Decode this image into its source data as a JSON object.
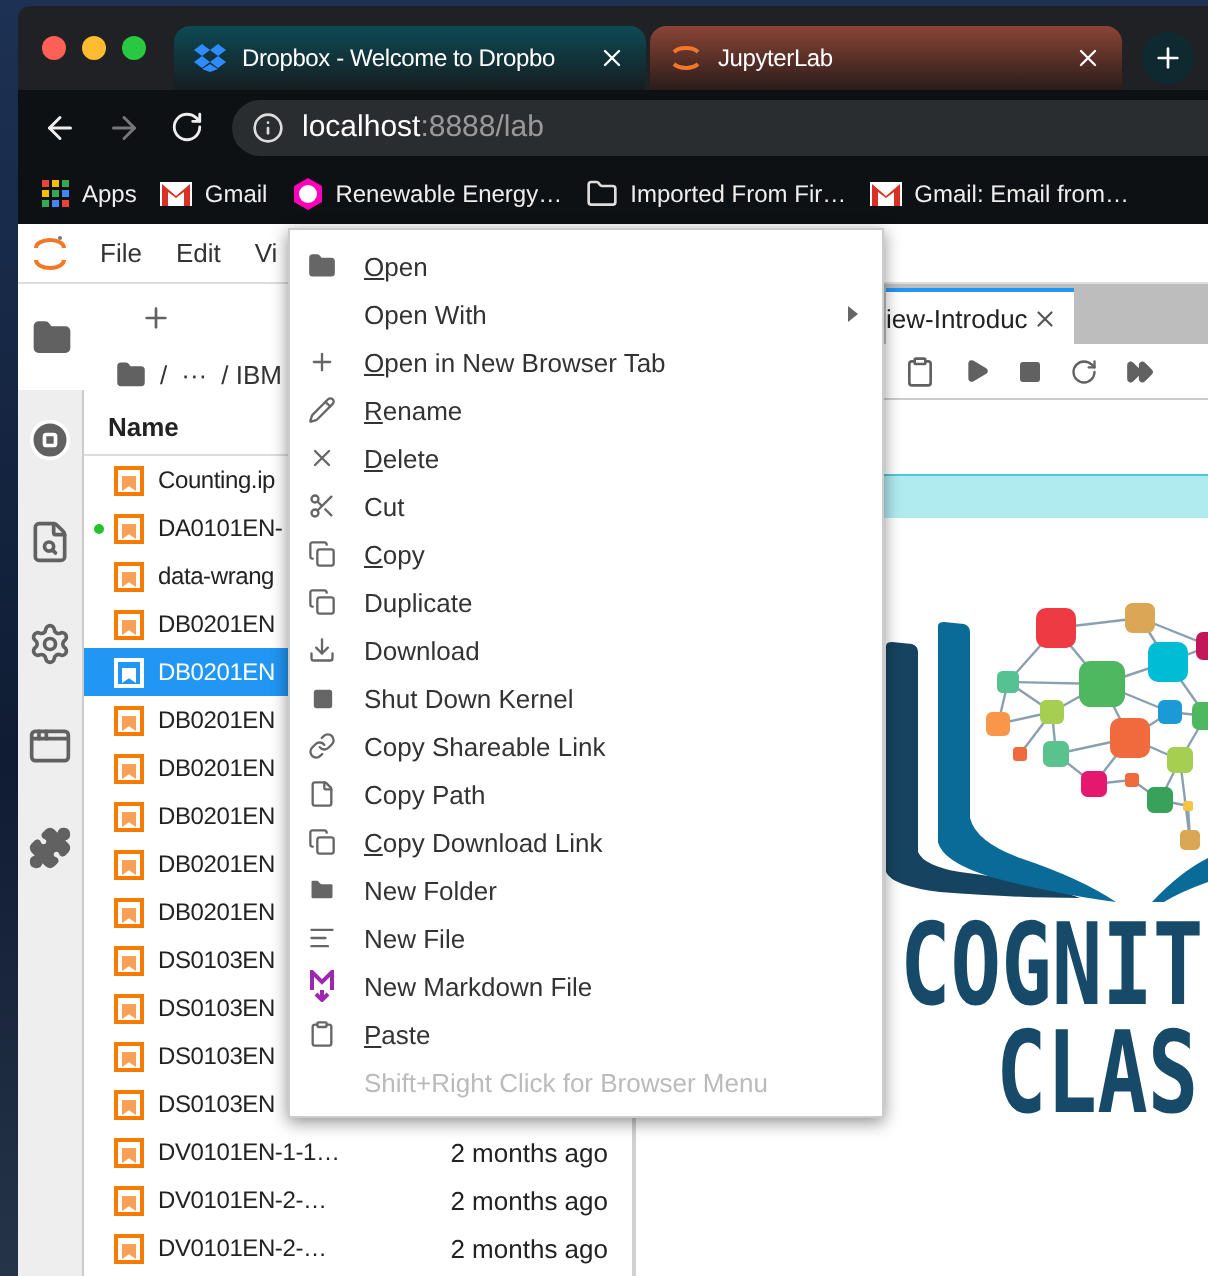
{
  "browser": {
    "tabs": [
      {
        "title": "Dropbox - Welcome to Dropbo",
        "selected": false
      },
      {
        "title": "JupyterLab",
        "selected": true
      }
    ],
    "address": {
      "host": "localhost",
      "path": ":8888/lab"
    },
    "bookmarks": [
      {
        "label": "Apps"
      },
      {
        "label": "Gmail"
      },
      {
        "label": "Renewable Energy…"
      },
      {
        "label": "Imported From Fir…"
      },
      {
        "label": "Gmail: Email from…"
      }
    ]
  },
  "jupyter": {
    "menu": [
      "File",
      "Edit",
      "Vi"
    ],
    "file_browser": {
      "breadcrumb": [
        "/",
        "···",
        "/ IBM"
      ],
      "column": "Name",
      "rows": [
        {
          "name": "Counting.ip",
          "selected": false,
          "running": false
        },
        {
          "name": "DA0101EN-",
          "selected": false,
          "running": true
        },
        {
          "name": "data-wrang",
          "selected": false,
          "running": false
        },
        {
          "name": "DB0201EN",
          "selected": false,
          "running": false
        },
        {
          "name": "DB0201EN",
          "selected": true,
          "running": false
        },
        {
          "name": "DB0201EN",
          "selected": false,
          "running": false
        },
        {
          "name": "DB0201EN",
          "selected": false,
          "running": false
        },
        {
          "name": "DB0201EN",
          "selected": false,
          "running": false
        },
        {
          "name": "DB0201EN",
          "selected": false,
          "running": false
        },
        {
          "name": "DB0201EN",
          "selected": false,
          "running": false
        },
        {
          "name": "DS0103EN",
          "selected": false,
          "running": false
        },
        {
          "name": "DS0103EN",
          "selected": false,
          "running": false
        },
        {
          "name": "DS0103EN",
          "selected": false,
          "running": false
        },
        {
          "name": "DS0103EN",
          "selected": false,
          "running": false
        },
        {
          "name": "DV0101EN-1-1…",
          "modified": "2 months ago",
          "selected": false,
          "running": false
        },
        {
          "name": "DV0101EN-2-…",
          "modified": "2 months ago",
          "selected": false,
          "running": false
        },
        {
          "name": "DV0101EN-2-…",
          "modified": "2 months ago",
          "selected": false,
          "running": false
        }
      ]
    },
    "notebook": {
      "tab": "iew-Introduc",
      "logo_lines": [
        "COGNIT",
        "CLAS"
      ]
    },
    "context_menu": [
      {
        "label": "Open",
        "mnemonic": true,
        "submenu": false,
        "disabled": false
      },
      {
        "label": "Open With",
        "mnemonic": false,
        "submenu": true,
        "disabled": false
      },
      {
        "label": "Open in New Browser Tab",
        "mnemonic": true,
        "submenu": false,
        "disabled": false
      },
      {
        "label": "Rename",
        "mnemonic": true,
        "submenu": false,
        "disabled": false
      },
      {
        "label": "Delete",
        "mnemonic": true,
        "submenu": false,
        "disabled": false
      },
      {
        "label": "Cut",
        "mnemonic": false,
        "submenu": false,
        "disabled": false
      },
      {
        "label": "Copy",
        "mnemonic": true,
        "submenu": false,
        "disabled": false
      },
      {
        "label": "Duplicate",
        "mnemonic": false,
        "submenu": false,
        "disabled": false
      },
      {
        "label": "Download",
        "mnemonic": false,
        "submenu": false,
        "disabled": false
      },
      {
        "label": "Shut Down Kernel",
        "mnemonic": false,
        "submenu": false,
        "disabled": false
      },
      {
        "label": "Copy Shareable Link",
        "mnemonic": false,
        "submenu": false,
        "disabled": false
      },
      {
        "label": "Copy Path",
        "mnemonic": false,
        "submenu": false,
        "disabled": false
      },
      {
        "label": "Copy Download Link",
        "mnemonic": true,
        "submenu": false,
        "disabled": false
      },
      {
        "label": "New Folder",
        "mnemonic": false,
        "submenu": false,
        "disabled": false
      },
      {
        "label": "New File",
        "mnemonic": false,
        "submenu": false,
        "disabled": false
      },
      {
        "label": "New Markdown File",
        "mnemonic": false,
        "submenu": false,
        "disabled": false
      },
      {
        "label": "Paste",
        "mnemonic": true,
        "submenu": false,
        "disabled": false
      },
      {
        "label": "Shift+Right Click for Browser Menu",
        "mnemonic": false,
        "submenu": false,
        "disabled": true
      }
    ]
  }
}
